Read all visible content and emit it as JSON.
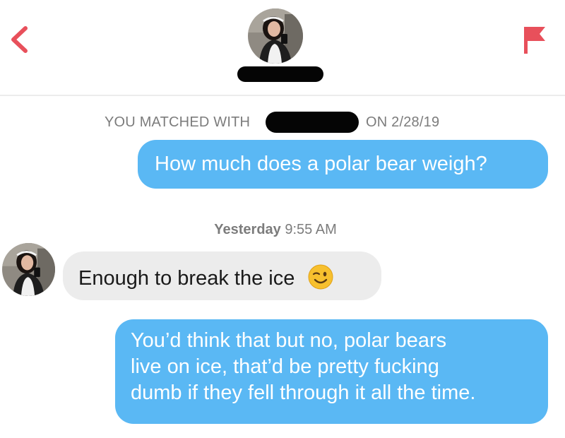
{
  "header": {
    "back_icon": "chevron-left-icon",
    "report_icon": "flag-icon",
    "accent_color": "#e8505b"
  },
  "match_info": {
    "prefix": "YOU MATCHED WITH",
    "suffix": "ON 2/28/19"
  },
  "messages": [
    {
      "direction": "outgoing",
      "text": "How much does a polar bear weigh?"
    },
    {
      "type": "timestamp",
      "day": "Yesterday",
      "time": "9:55 AM"
    },
    {
      "direction": "incoming",
      "text": "Enough to break the ice",
      "emoji": "winking-face-icon"
    },
    {
      "direction": "outgoing",
      "lines": [
        "You’d think that but no, polar bears",
        "live on ice, that’d be pretty fucking",
        "dumb if they fell through it all the time."
      ]
    }
  ],
  "colors": {
    "outgoing_bubble": "#5ab8f4",
    "incoming_bubble": "#ececec",
    "meta_text": "#7c7c7c"
  }
}
